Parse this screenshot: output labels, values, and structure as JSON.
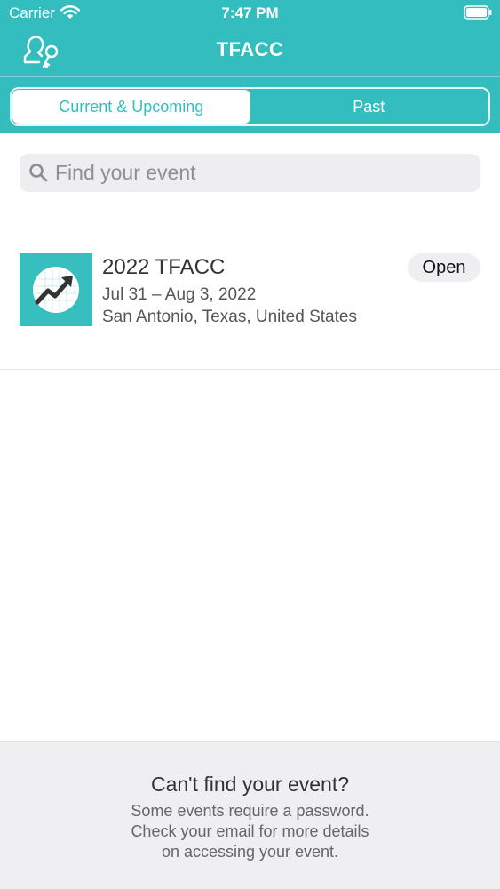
{
  "status_bar": {
    "carrier": "Carrier",
    "time": "7:47 PM"
  },
  "header": {
    "title": "TFACC"
  },
  "tabs": [
    {
      "label": "Current & Upcoming",
      "active": true
    },
    {
      "label": "Past",
      "active": false
    }
  ],
  "search": {
    "placeholder": "Find your event",
    "value": ""
  },
  "events": [
    {
      "name": "2022 TFACC",
      "dates": "Jul 31 – Aug 3, 2022",
      "location": "San Antonio, Texas, United States",
      "action_label": "Open"
    }
  ],
  "footer": {
    "title": "Can't find your event?",
    "lines": [
      "Some events require a password.",
      "Check your email for more details",
      "on accessing your event."
    ]
  },
  "colors": {
    "accent": "#34bdbf",
    "logo_bg": "#37bfc0",
    "footer_bg": "#efeff2"
  }
}
